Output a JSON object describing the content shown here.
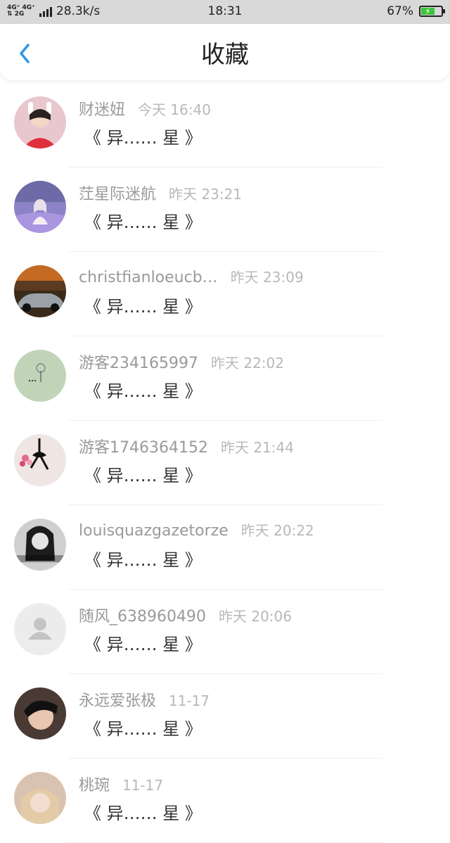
{
  "status_bar": {
    "network_top": "4G⁺ 4G⁺",
    "network_bottom": "⇅ 2G",
    "speed": "28.3k/s",
    "time": "18:31",
    "battery": "67%",
    "battery_level": 0.67,
    "battery_color": "#3cc43c"
  },
  "nav": {
    "title": "收藏",
    "back_icon": "chevron-left-icon",
    "accent": "#2a96e6"
  },
  "items": [
    {
      "name": "财迷妞",
      "time": "今天 16:40",
      "preview": "《 异…… 星 》",
      "avatar": "photo-girl-bunny-ears"
    },
    {
      "name": "茳星际迷航",
      "time": "昨天 23:21",
      "preview": "《 异…… 星 》",
      "avatar": "photo-girl-lavender"
    },
    {
      "name": "christfianloeucb…",
      "time": "昨天 23:09",
      "preview": "《 异…… 星 》",
      "avatar": "photo-car"
    },
    {
      "name": "游客234165997",
      "time": "昨天 22:02",
      "preview": "《 异…… 星 》",
      "avatar": "photo-tree"
    },
    {
      "name": "游客1746364152",
      "time": "昨天 21:44",
      "preview": "《 异…… 星 》",
      "avatar": "photo-bow-flowers"
    },
    {
      "name": "louisquazgazetorze",
      "time": "昨天 20:22",
      "preview": "《 异…… 星 》",
      "avatar": "photo-bw-woman"
    },
    {
      "name": "随风_638960490",
      "time": "昨天 20:06",
      "preview": "《 异…… 星 》",
      "avatar": "default-user-icon"
    },
    {
      "name": "永远爱张极",
      "time": "11-17",
      "preview": "《 异…… 星 》",
      "avatar": "photo-boy"
    },
    {
      "name": "桃琬",
      "time": "11-17",
      "preview": "《 异…… 星 》",
      "avatar": "photo-blonde"
    }
  ]
}
